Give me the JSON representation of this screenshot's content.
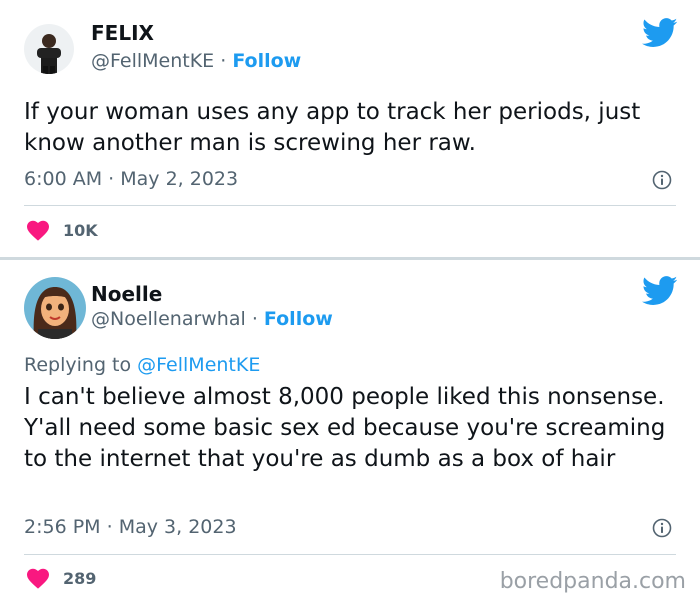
{
  "tweet1": {
    "name": "FELIX",
    "handle": "@FellMentKE",
    "separator": "·",
    "follow": "Follow",
    "text": "If your woman uses any app to track her periods, just know another man is screwing her raw.",
    "time": "6:00 AM",
    "date": "May 2, 2023",
    "likes": "10K",
    "avatar_icon": "person-avatar",
    "brand_icon": "twitter-bird-icon"
  },
  "tweet2": {
    "name": "Noelle",
    "handle": "@Noellenarwhal",
    "separator": "·",
    "follow": "Follow",
    "replying_prefix": "Replying to",
    "replying_handle": "@FellMentKE",
    "text": "I can't believe almost 8,000 people liked this nonsense. Y'all need some basic sex ed because you're screaming to the internet that you're as dumb as a box of hair",
    "time": "2:56 PM",
    "date": "May 3, 2023",
    "likes": "289",
    "avatar_icon": "cartoon-avatar",
    "brand_icon": "twitter-bird-icon"
  },
  "watermark": "boredpanda.com",
  "colors": {
    "twitter_blue": "#1d9bf0",
    "heart": "#f91880",
    "secondary_text": "#536471",
    "divider": "#cfd9de"
  }
}
